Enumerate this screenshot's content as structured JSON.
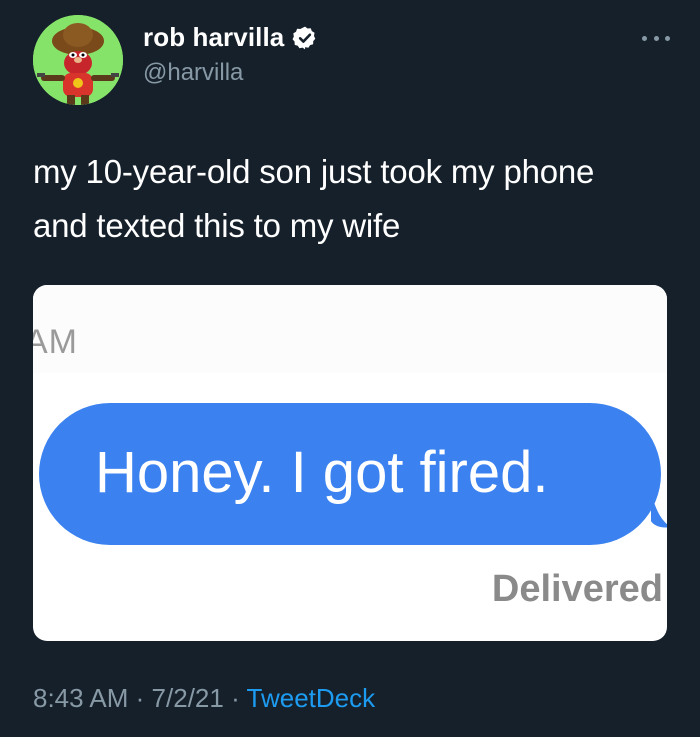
{
  "author": {
    "display_name": "rob harvilla",
    "handle": "@harvilla",
    "verified": true,
    "avatar_icon": "cartoon-character-avatar-icon"
  },
  "tweet": {
    "text": "my 10-year-old son just took my phone and texted this to my wife"
  },
  "media": {
    "time_fragment": "AM",
    "message": "Honey. I got fired.",
    "status": "Delivered"
  },
  "meta": {
    "time": "8:43 AM",
    "sep1": "·",
    "date": "7/2/21",
    "sep2": "·",
    "source": "TweetDeck"
  },
  "colors": {
    "background": "#15202b",
    "bubble": "#3b82f0",
    "link": "#1d9bf0",
    "muted": "#8899a6",
    "avatar_bg": "#86e36a"
  }
}
